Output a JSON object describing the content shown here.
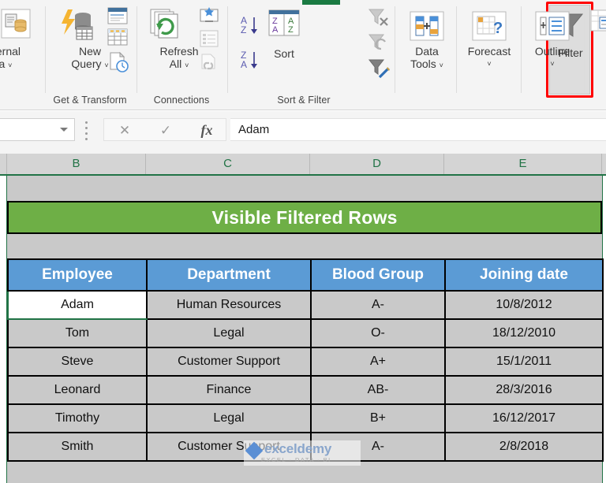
{
  "app": "Microsoft Excel",
  "ribbon": {
    "groups": [
      {
        "name": "get-external-data",
        "label": "",
        "buttons": [
          {
            "name": "get-external-data-button",
            "label1": "xternal",
            "label2": "ta",
            "chevron": "˅",
            "icon": "external-data-icon"
          }
        ]
      },
      {
        "name": "get-and-transform",
        "label": "Get & Transform",
        "buttons": [
          {
            "name": "new-query-button",
            "label1": "New",
            "label2": "Query",
            "chevron": "˅",
            "icon": "new-query-icon"
          },
          {
            "name": "show-queries-button",
            "label1": "",
            "label2": "",
            "chevron": "",
            "icon": "show-queries-icon"
          },
          {
            "name": "from-table-button",
            "label1": "",
            "label2": "",
            "chevron": "",
            "icon": "from-table-icon"
          },
          {
            "name": "recent-sources-button",
            "label1": "",
            "label2": "",
            "chevron": "",
            "icon": "recent-sources-icon"
          }
        ]
      },
      {
        "name": "connections",
        "label": "Connections",
        "buttons": [
          {
            "name": "refresh-all-button",
            "label1": "Refresh",
            "label2": "All",
            "chevron": "˅",
            "icon": "refresh-all-icon"
          },
          {
            "name": "connections-button",
            "label1": "",
            "label2": "",
            "chevron": "",
            "icon": "connections-icon"
          },
          {
            "name": "properties-button",
            "label1": "",
            "label2": "",
            "chevron": "",
            "icon": "properties-icon"
          },
          {
            "name": "edit-links-button",
            "label1": "",
            "label2": "",
            "chevron": "",
            "icon": "edit-links-icon"
          }
        ]
      },
      {
        "name": "sort-and-filter",
        "label": "Sort & Filter",
        "buttons": [
          {
            "name": "sort-ascending-button",
            "label1": "",
            "label2": "",
            "chevron": "",
            "icon": "sort-a-to-z-icon"
          },
          {
            "name": "sort-descending-button",
            "label1": "",
            "label2": "",
            "chevron": "",
            "icon": "sort-z-to-a-icon"
          },
          {
            "name": "sort-button",
            "label1": "Sort",
            "label2": "",
            "chevron": "",
            "icon": "sort-icon"
          },
          {
            "name": "filter-button",
            "label1": "Filter",
            "label2": "",
            "chevron": "",
            "icon": "filter-funnel-icon"
          },
          {
            "name": "clear-filter-button",
            "label1": "",
            "label2": "",
            "chevron": "",
            "icon": "clear-filter-icon"
          },
          {
            "name": "reapply-filter-button",
            "label1": "",
            "label2": "",
            "chevron": "",
            "icon": "reapply-filter-icon"
          },
          {
            "name": "advanced-filter-button",
            "label1": "",
            "label2": "",
            "chevron": "",
            "icon": "advanced-filter-icon"
          }
        ]
      },
      {
        "name": "data-tools",
        "label": "",
        "buttons": [
          {
            "name": "data-tools-button",
            "label1": "Data",
            "label2": "Tools",
            "chevron": "˅",
            "icon": "data-tools-icon"
          }
        ]
      },
      {
        "name": "forecast",
        "label": "",
        "buttons": [
          {
            "name": "forecast-button",
            "label1": "Forecast",
            "label2": "",
            "chevron": "˅",
            "icon": "forecast-icon"
          }
        ]
      },
      {
        "name": "outline",
        "label": "",
        "buttons": [
          {
            "name": "outline-button",
            "label1": "Outline",
            "label2": "",
            "chevron": "˅",
            "icon": "outline-icon"
          }
        ]
      }
    ],
    "highlight_color": "#ff0000",
    "highlighted_button": "Filter"
  },
  "formula_bar": {
    "name_box_value": "",
    "cancel_icon": "✕",
    "enter_icon": "✓",
    "function_icon": "fx",
    "formula_value": "Adam"
  },
  "grid": {
    "column_headers": [
      "B",
      "C",
      "D",
      "E"
    ],
    "header_color": "#217346"
  },
  "sheet": {
    "banner_title": "Visible Filtered Rows",
    "banner_color": "#6eaf46",
    "table_header_color": "#5b9bd5",
    "table": {
      "headers": [
        "Employee",
        "Department",
        "Blood Group",
        "Joining date"
      ],
      "rows": [
        [
          "Adam",
          "Human Resources",
          "A-",
          "10/8/2012"
        ],
        [
          "Tom",
          "Legal",
          "O-",
          "18/12/2010"
        ],
        [
          "Steve",
          "Customer Support",
          "A+",
          "15/1/2011"
        ],
        [
          "Leonard",
          "Finance",
          "AB-",
          "28/3/2016"
        ],
        [
          "Timothy",
          "Legal",
          "B+",
          "16/12/2017"
        ],
        [
          "Smith",
          "Customer Support",
          "A-",
          "2/8/2018"
        ]
      ]
    },
    "selected_cell": "Adam"
  },
  "watermark": {
    "title": "exceldemy",
    "subtitle": "EXCEL · DATA · BI"
  }
}
